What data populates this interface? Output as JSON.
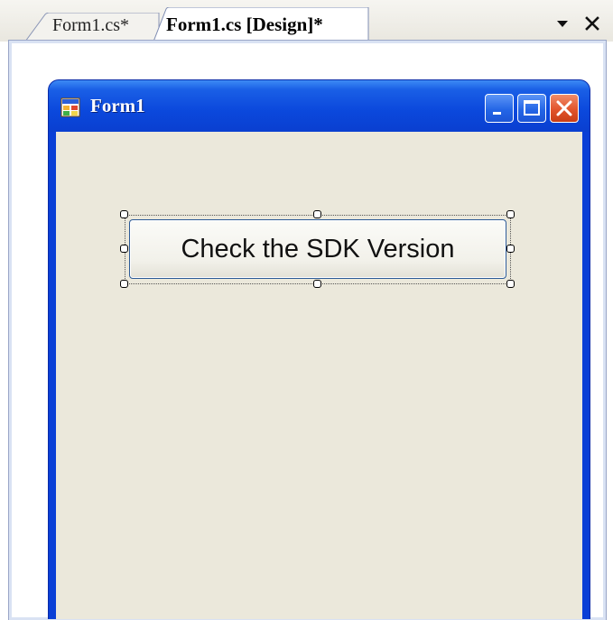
{
  "tabs": [
    {
      "label": "Form1.cs*",
      "active": false
    },
    {
      "label": "Form1.cs [Design]*",
      "active": true
    }
  ],
  "strip_controls": {
    "dropdown_icon": "chevron-down-icon",
    "close_icon": "close-icon"
  },
  "form": {
    "title": "Form1",
    "icon": "form-app-icon",
    "caption_buttons": [
      "minimize-icon",
      "maximize-icon",
      "close-icon"
    ]
  },
  "button": {
    "label": "Check the SDK Version",
    "selected": true
  },
  "colors": {
    "titlebar": "#0a48dc",
    "client": "#ebe8db",
    "close_button": "#e2542b"
  }
}
